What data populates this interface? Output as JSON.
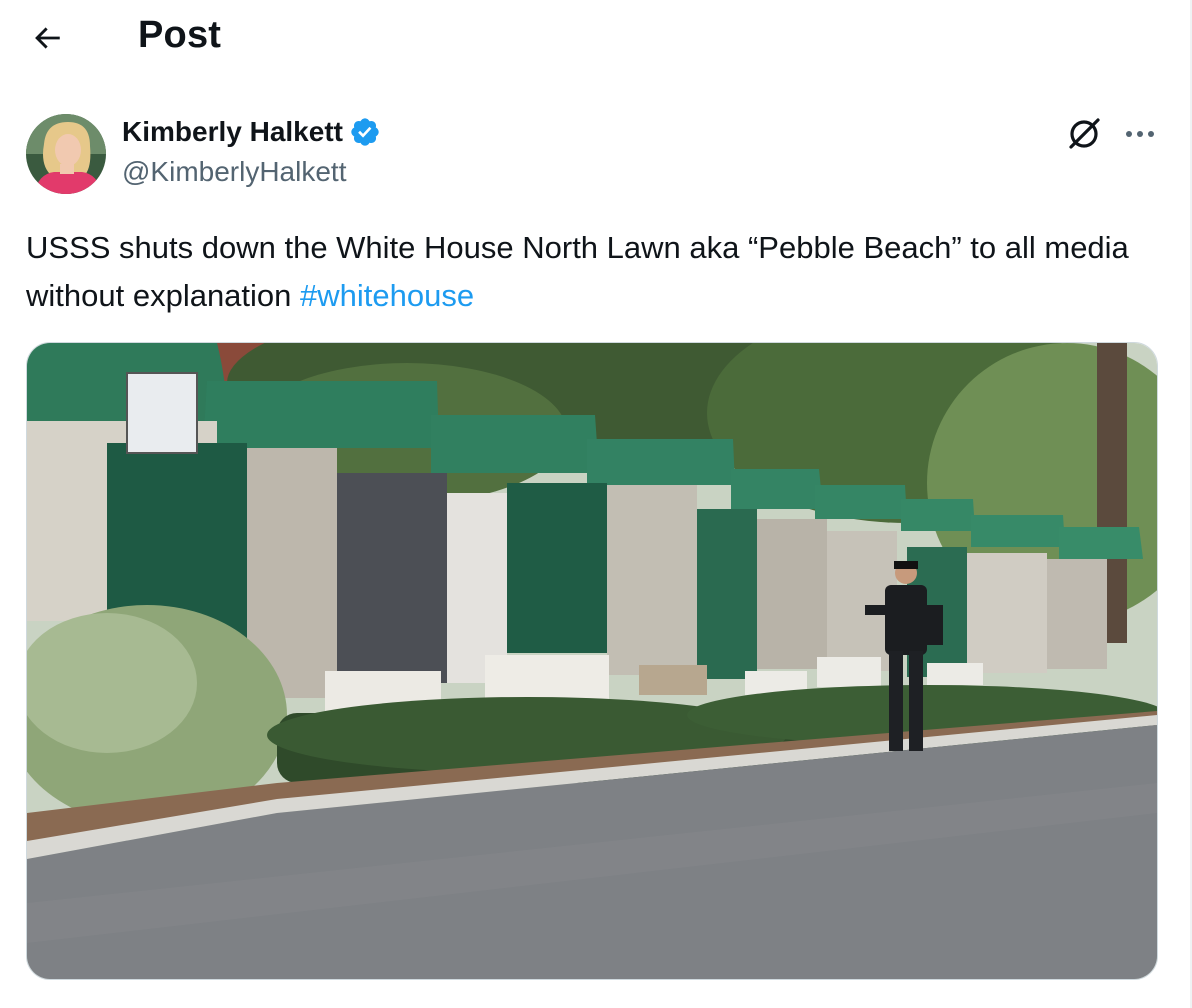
{
  "header": {
    "title": "Post",
    "back_icon": "arrow-left-icon"
  },
  "post": {
    "author": {
      "display_name": "Kimberly Halkett",
      "handle": "@KimberlyHalkett",
      "verified": true,
      "verified_color": "#1d9bf0"
    },
    "text": "USSS shuts down the White House North Lawn aka “Pebble Beach” to all media without explanation ",
    "hashtag": "#whitehouse",
    "actions": {
      "grok_icon": "grok-icon",
      "more_icon": "more-horizontal-icon"
    },
    "media": {
      "type": "photo"
    }
  },
  "colors": {
    "accent": "#1d9bf0",
    "text": "#0f1419",
    "secondary": "#536471"
  }
}
